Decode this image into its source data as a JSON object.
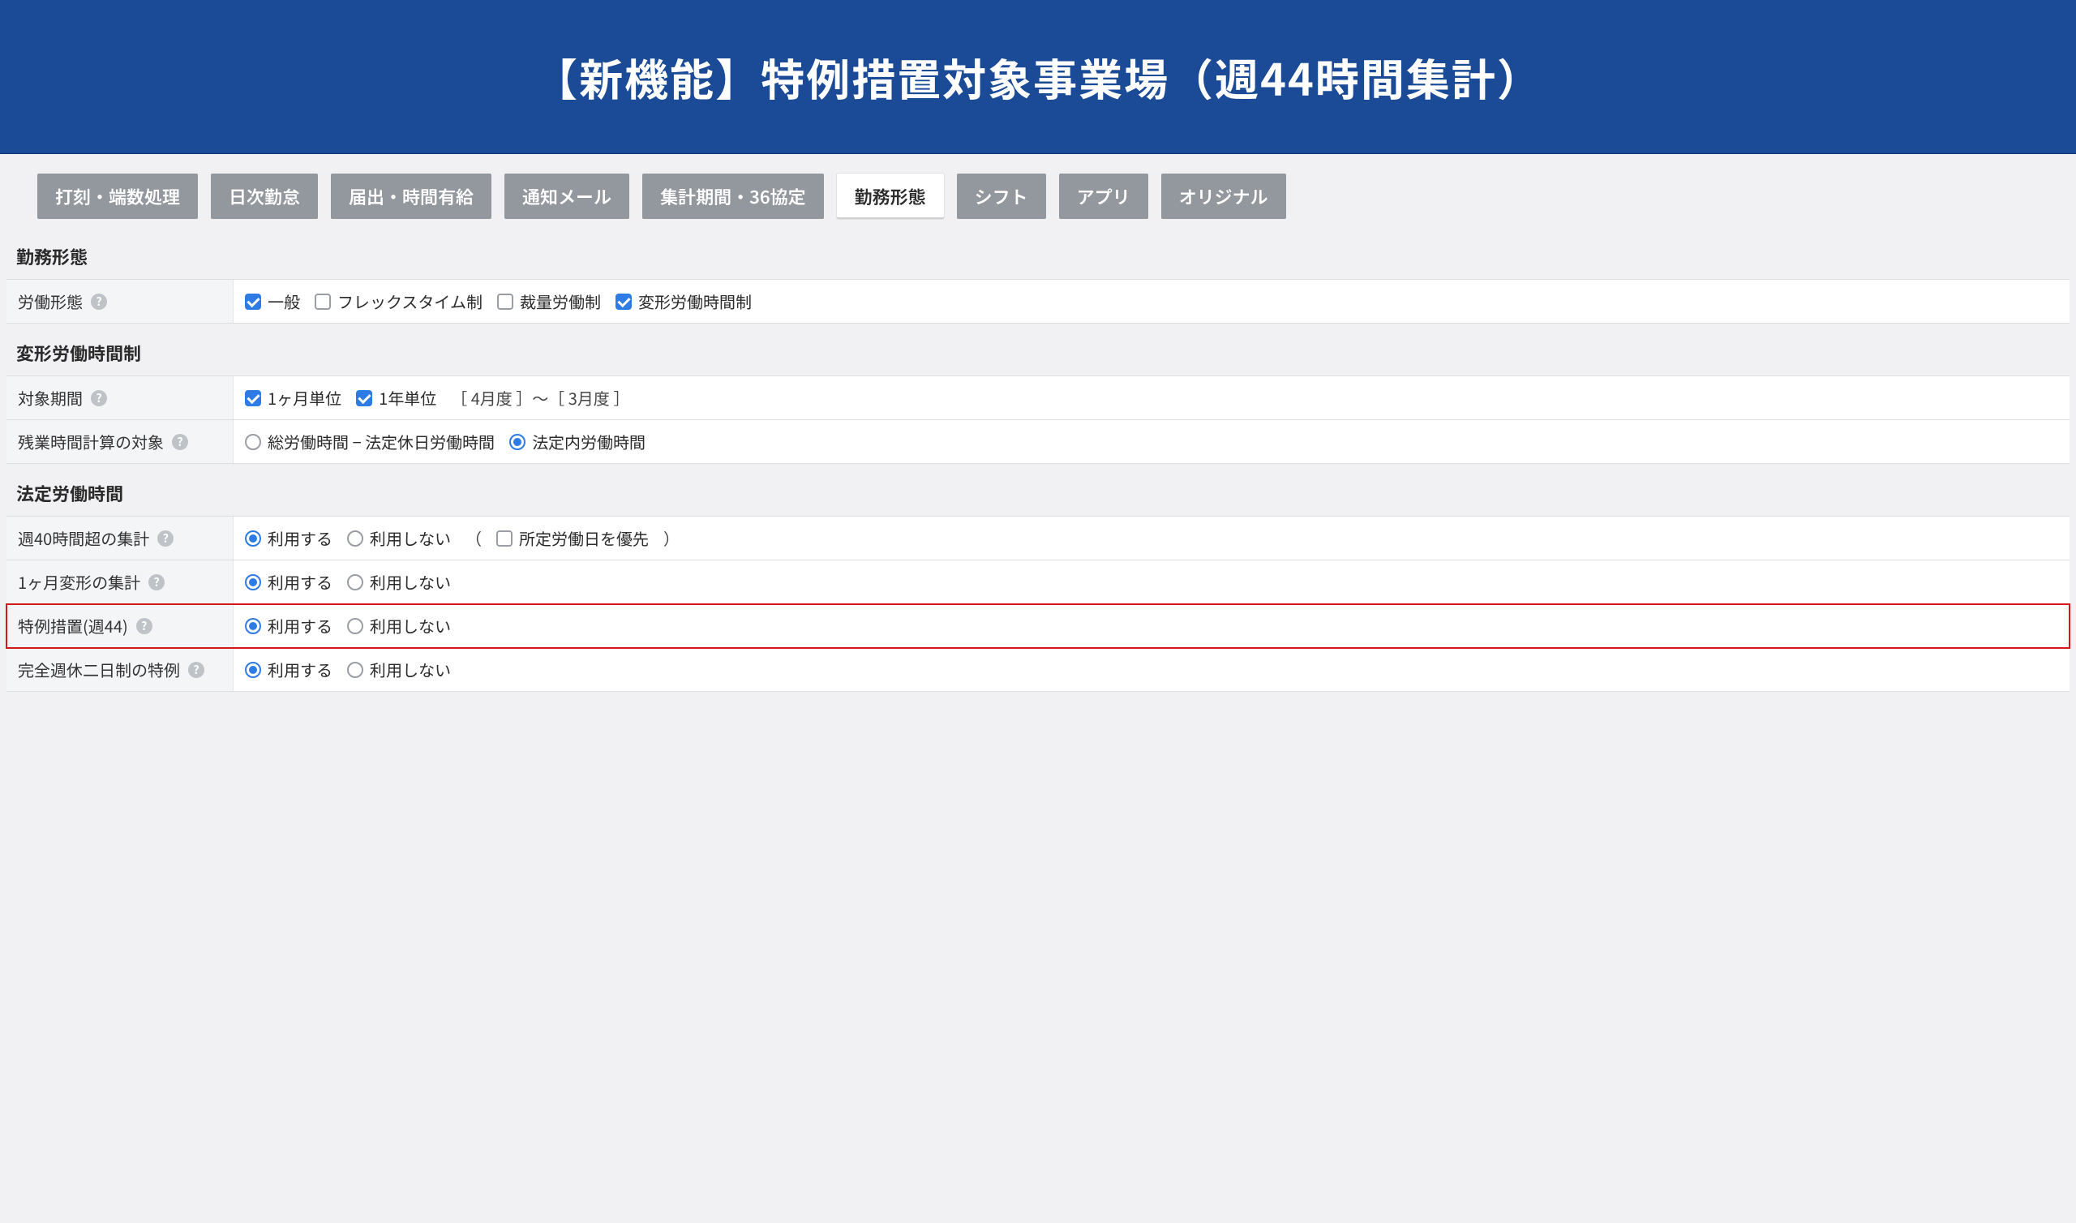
{
  "banner": {
    "title": "【新機能】特例措置対象事業場（週44時間集計）"
  },
  "tabs": [
    {
      "label": "打刻・端数処理",
      "active": false
    },
    {
      "label": "日次勤怠",
      "active": false
    },
    {
      "label": "届出・時間有給",
      "active": false
    },
    {
      "label": "通知メール",
      "active": false
    },
    {
      "label": "集計期間・36協定",
      "active": false
    },
    {
      "label": "勤務形態",
      "active": true
    },
    {
      "label": "シフト",
      "active": false
    },
    {
      "label": "アプリ",
      "active": false
    },
    {
      "label": "オリジナル",
      "active": false
    }
  ],
  "sections": {
    "work_style": {
      "title": "勤務形態",
      "row_label": "労働形態",
      "options": {
        "general": {
          "label": "一般",
          "checked": true
        },
        "flex": {
          "label": "フレックスタイム制",
          "checked": false
        },
        "discretion": {
          "label": "裁量労働制",
          "checked": false
        },
        "variable": {
          "label": "変形労働時間制",
          "checked": true
        }
      }
    },
    "variable": {
      "title": "変形労働時間制",
      "period": {
        "label": "対象期間",
        "one_month": {
          "label": "1ヶ月単位",
          "checked": true
        },
        "one_year": {
          "label": "1年単位",
          "checked": true,
          "range": "［ 4月度 ］～［ 3月度 ］"
        }
      },
      "overtime_calc": {
        "label": "残業時間計算の対象",
        "opt_total": "総労働時間 − 法定休日労働時間",
        "opt_legal": "法定内労働時間",
        "selected": "legal"
      }
    },
    "legal": {
      "title": "法定労働時間",
      "rows": {
        "week40": {
          "label": "週40時間超の集計",
          "use": "利用する",
          "not_use": "利用しない",
          "extra_cb": "所定労働日を優先",
          "selected": "use",
          "extra_checked": false
        },
        "onemonth": {
          "label": "1ヶ月変形の集計",
          "use": "利用する",
          "not_use": "利用しない",
          "selected": "use"
        },
        "week44": {
          "label": "特例措置(週44)",
          "use": "利用する",
          "not_use": "利用しない",
          "selected": "use",
          "highlight": true
        },
        "fullweekend": {
          "label": "完全週休二日制の特例",
          "use": "利用する",
          "not_use": "利用しない",
          "selected": "use"
        }
      }
    }
  }
}
